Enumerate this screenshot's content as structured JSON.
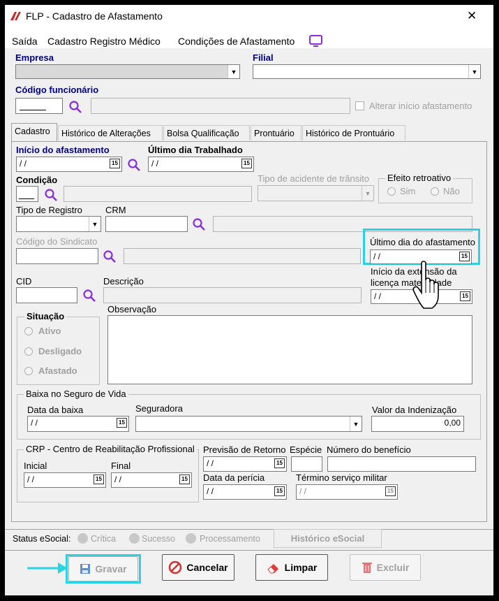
{
  "window": {
    "title": "FLP - Cadastro de Afastamento",
    "close": "✕"
  },
  "menu": {
    "items": [
      "Saída",
      "Cadastro Registro Médico",
      "Condições de Afastamento"
    ]
  },
  "top": {
    "empresa_label": "Empresa",
    "filial_label": "Filial",
    "codigo_label": "Código funcionário",
    "alterar_label": "Alterar início afastamento"
  },
  "tabs": [
    "Cadastro",
    "Histórico de Alterações",
    "Bolsa Qualificação",
    "Prontuário",
    "Histórico de Prontuário"
  ],
  "cadastro": {
    "inicio_label": "Início do afastamento",
    "inicio_value": " / /",
    "ultimo_trab_label": "Último dia Trabalhado",
    "ultimo_trab_value": " / /",
    "condicao_label": "Condição",
    "tipo_acidente_label": "Tipo de acidente de trânsito",
    "efeito_label": "Efeito retroativo",
    "efeito_sim": "Sim",
    "efeito_nao": "Não",
    "tipo_registro_label": "Tipo de Registro",
    "crm_label": "CRM",
    "codigo_sindicato_label": "Código do Sindicato",
    "ultimo_afast_label": "Último dia do afastamento",
    "ultimo_afast_value": " / /",
    "inicio_ext_label_1": "Início da extensão da",
    "inicio_ext_label_2": "licença maternidade",
    "inicio_ext_value": " / /",
    "cid_label": "CID",
    "descricao_label": "Descrição",
    "situacao_label": "Situação",
    "situacao_ativo": "Ativo",
    "situacao_desligado": "Desligado",
    "situacao_afastado": "Afastado",
    "observacao_label": "Observação"
  },
  "seguro": {
    "group_label": "Baixa no Seguro de Vida",
    "data_baixa_label": "Data da baixa",
    "data_baixa_value": " / /",
    "seguradora_label": "Seguradora",
    "valor_label": "Valor da Indenização",
    "valor_value": "0,00"
  },
  "crp": {
    "group_label": "CRP - Centro de Reabilitação Profissional",
    "inicial_label": "Inicial",
    "inicial_value": " / /",
    "final_label": "Final",
    "final_value": " / /",
    "previsao_label": "Previsão de Retorno",
    "previsao_value": " / /",
    "especie_label": "Espécie",
    "numero_label": "Número do benefício",
    "pericia_label": "Data da perícia",
    "pericia_value": " / /",
    "termino_label": "Término serviço militar",
    "termino_value": " / /"
  },
  "status": {
    "label": "Status eSocial:",
    "critica": "Crítica",
    "sucesso": "Sucesso",
    "processamento": "Processamento",
    "historico_btn": "Histórico eSocial"
  },
  "buttons": {
    "gravar": "Gravar",
    "cancelar": "Cancelar",
    "limpar": "Limpar",
    "excluir": "Excluir"
  },
  "calendar_glyph": "15",
  "colors": {
    "highlight": "#29d3e5",
    "accent_purple": "#8a2be2",
    "label_navy": "#000080",
    "cancel_red": "#d32f2f"
  }
}
